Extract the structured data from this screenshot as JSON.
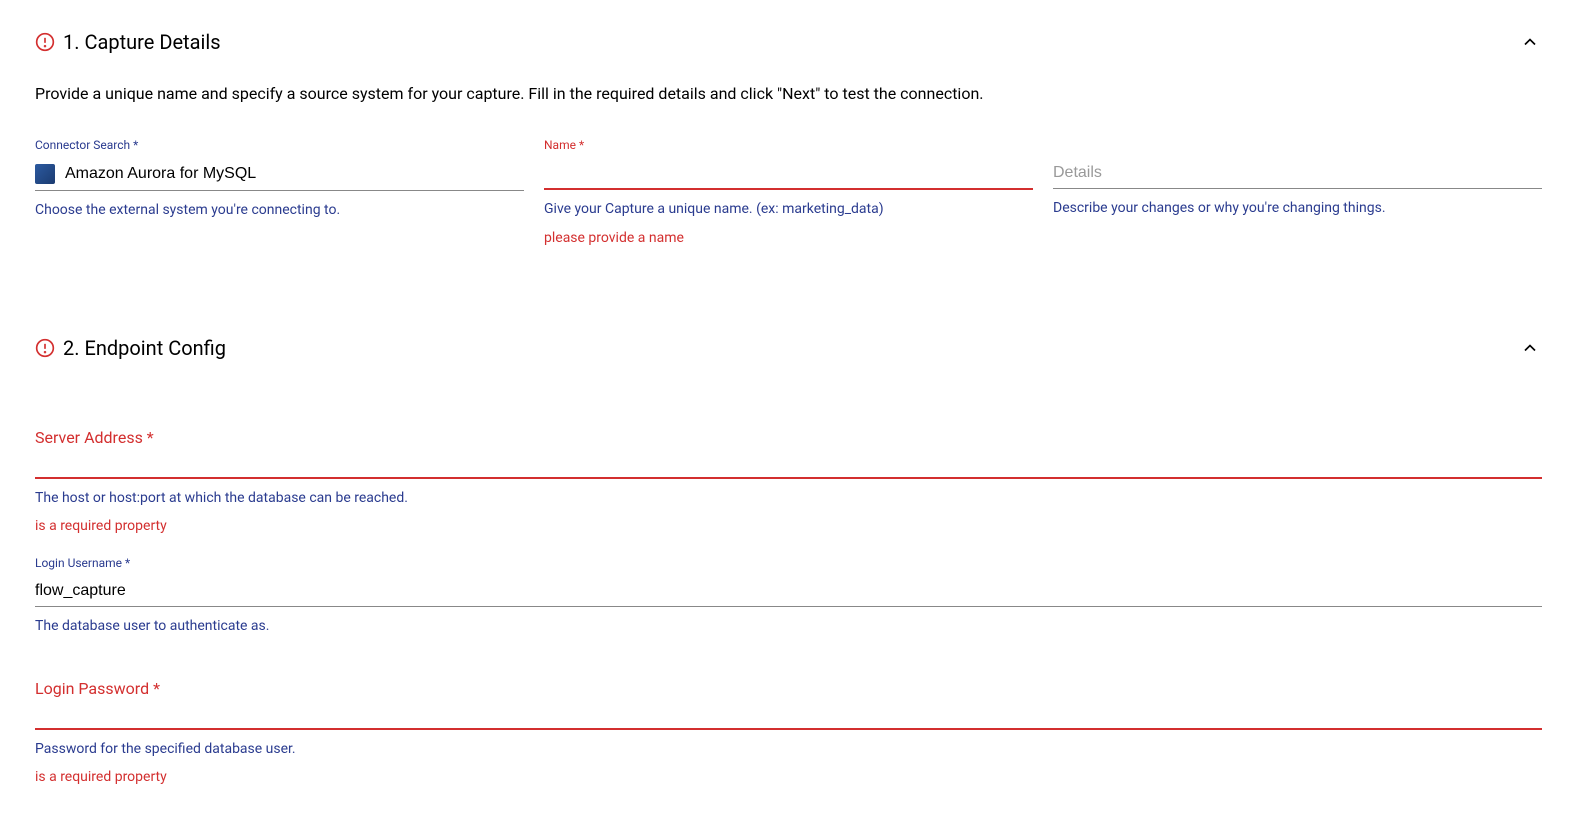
{
  "section1": {
    "title": "1. Capture Details",
    "description": "Provide a unique name and specify a source system for your capture. Fill in the required details and click \"Next\" to test the connection.",
    "connector": {
      "label": "Connector Search *",
      "value": "Amazon Aurora for MySQL",
      "helper": "Choose the external system you're connecting to."
    },
    "name": {
      "label": "Name *",
      "value": "",
      "helper": "Give your Capture a unique name. (ex: marketing_data)",
      "error": "please provide a name"
    },
    "details": {
      "label": "Details",
      "value": "",
      "helper": "Describe your changes or why you're changing things."
    }
  },
  "section2": {
    "title": "2. Endpoint Config",
    "server_address": {
      "label": "Server Address *",
      "value": "",
      "helper": "The host or host:port at which the database can be reached.",
      "error": "is a required property"
    },
    "login_username": {
      "label": "Login Username *",
      "value": "flow_capture",
      "helper": "The database user to authenticate as."
    },
    "login_password": {
      "label": "Login Password *",
      "value": "",
      "helper": "Password for the specified database user.",
      "error": "is a required property"
    }
  }
}
